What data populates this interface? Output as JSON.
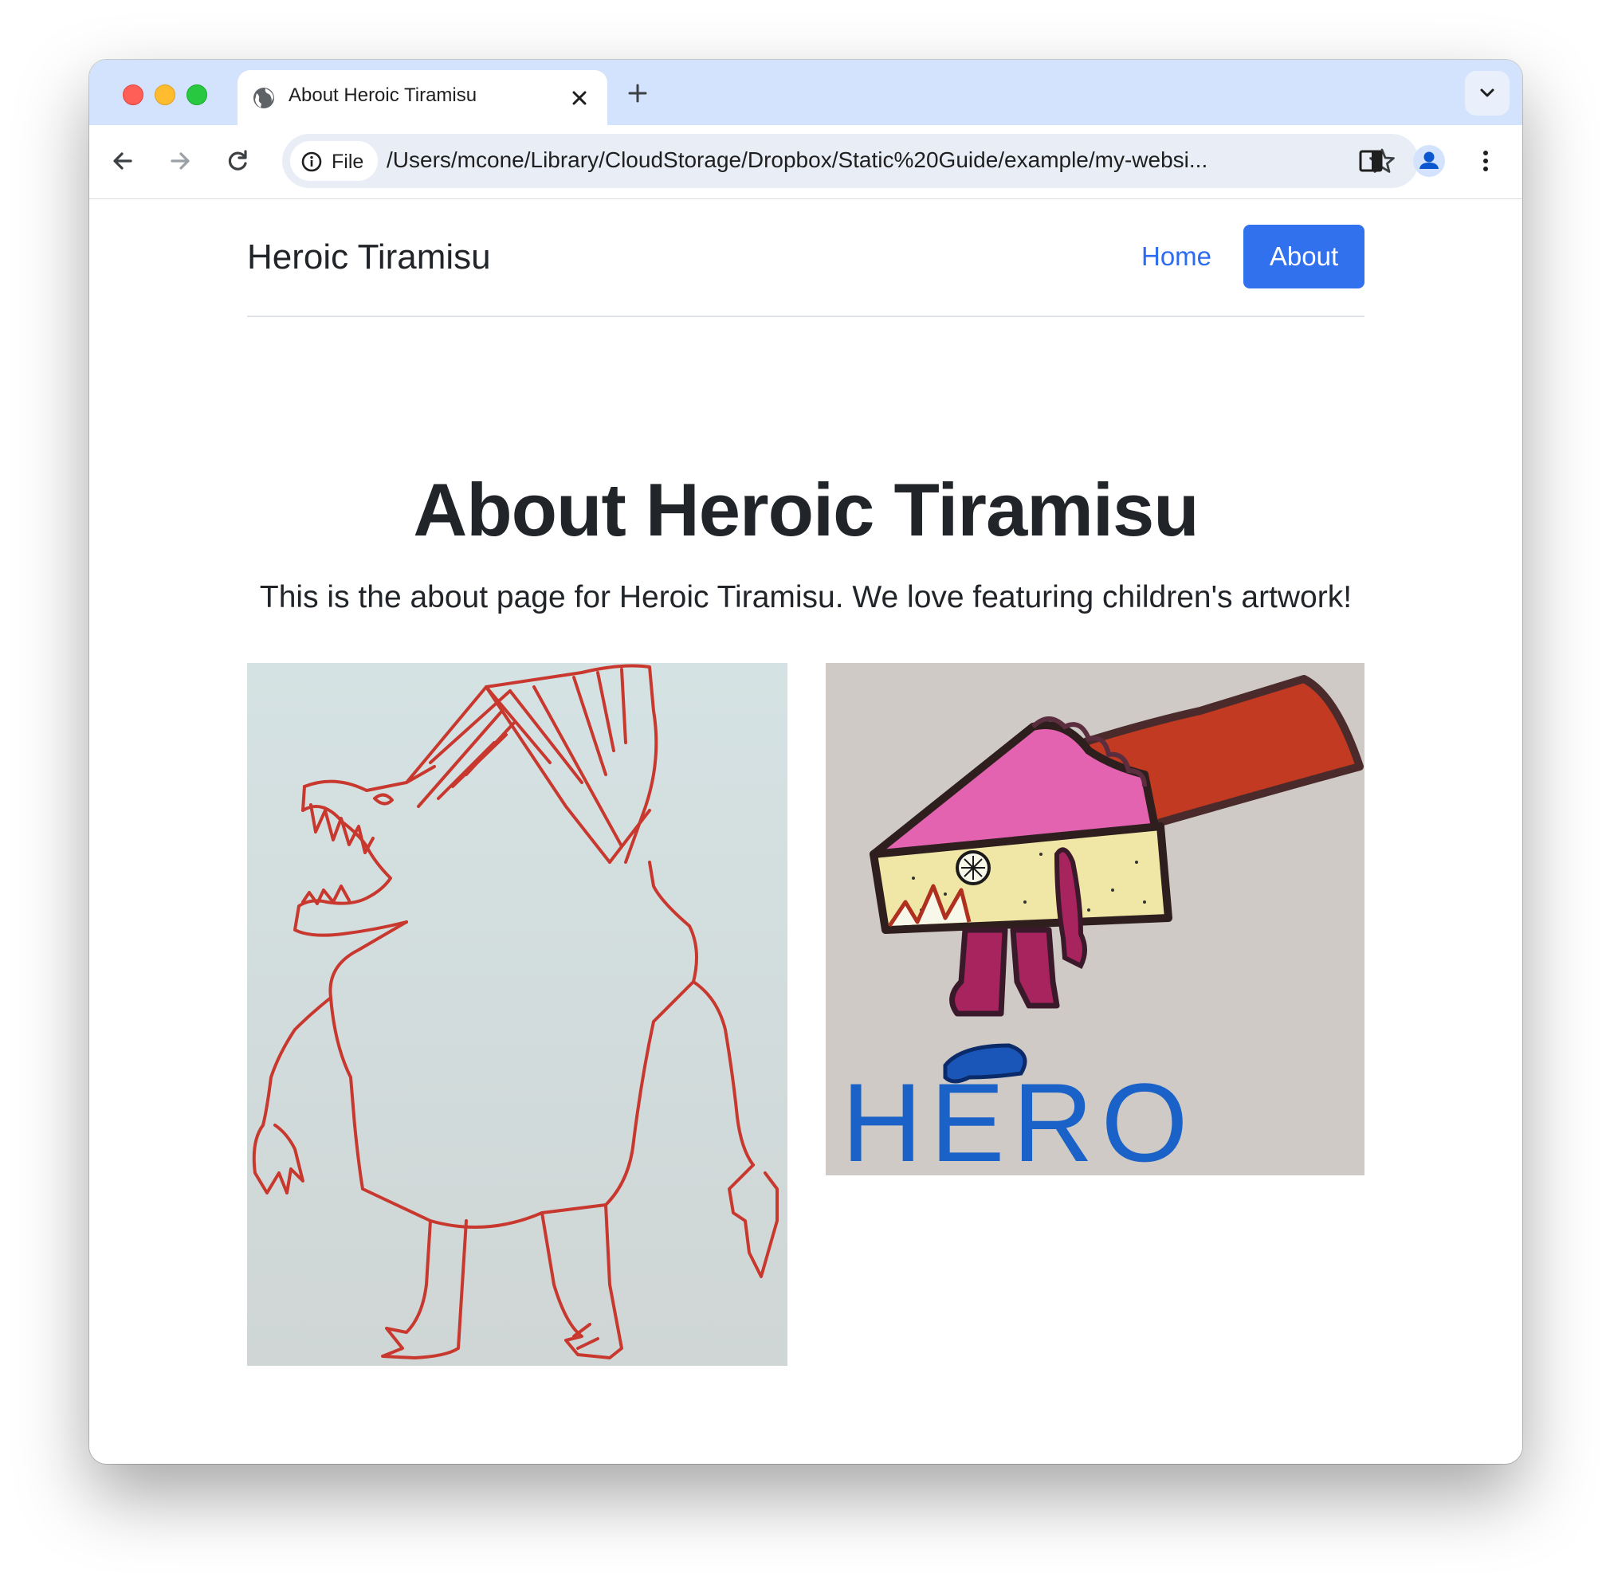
{
  "browser": {
    "tab_title": "About Heroic Tiramisu",
    "new_tab_icon": "plus-icon",
    "tab_menu_icon": "chevron-down-icon",
    "address_chip_label": "File",
    "address_url": "/Users/mcone/Library/CloudStorage/Dropbox/Static%20Guide/example/my-websi..."
  },
  "site": {
    "brand": "Heroic Tiramisu",
    "nav": {
      "home": "Home",
      "about": "About"
    },
    "accent_color": "#3271ee"
  },
  "main": {
    "title": "About Heroic Tiramisu",
    "lead": "This is the about page for Heroic Tiramisu. We love featuring children's artwork!",
    "artwork_2_text": "HERO"
  }
}
